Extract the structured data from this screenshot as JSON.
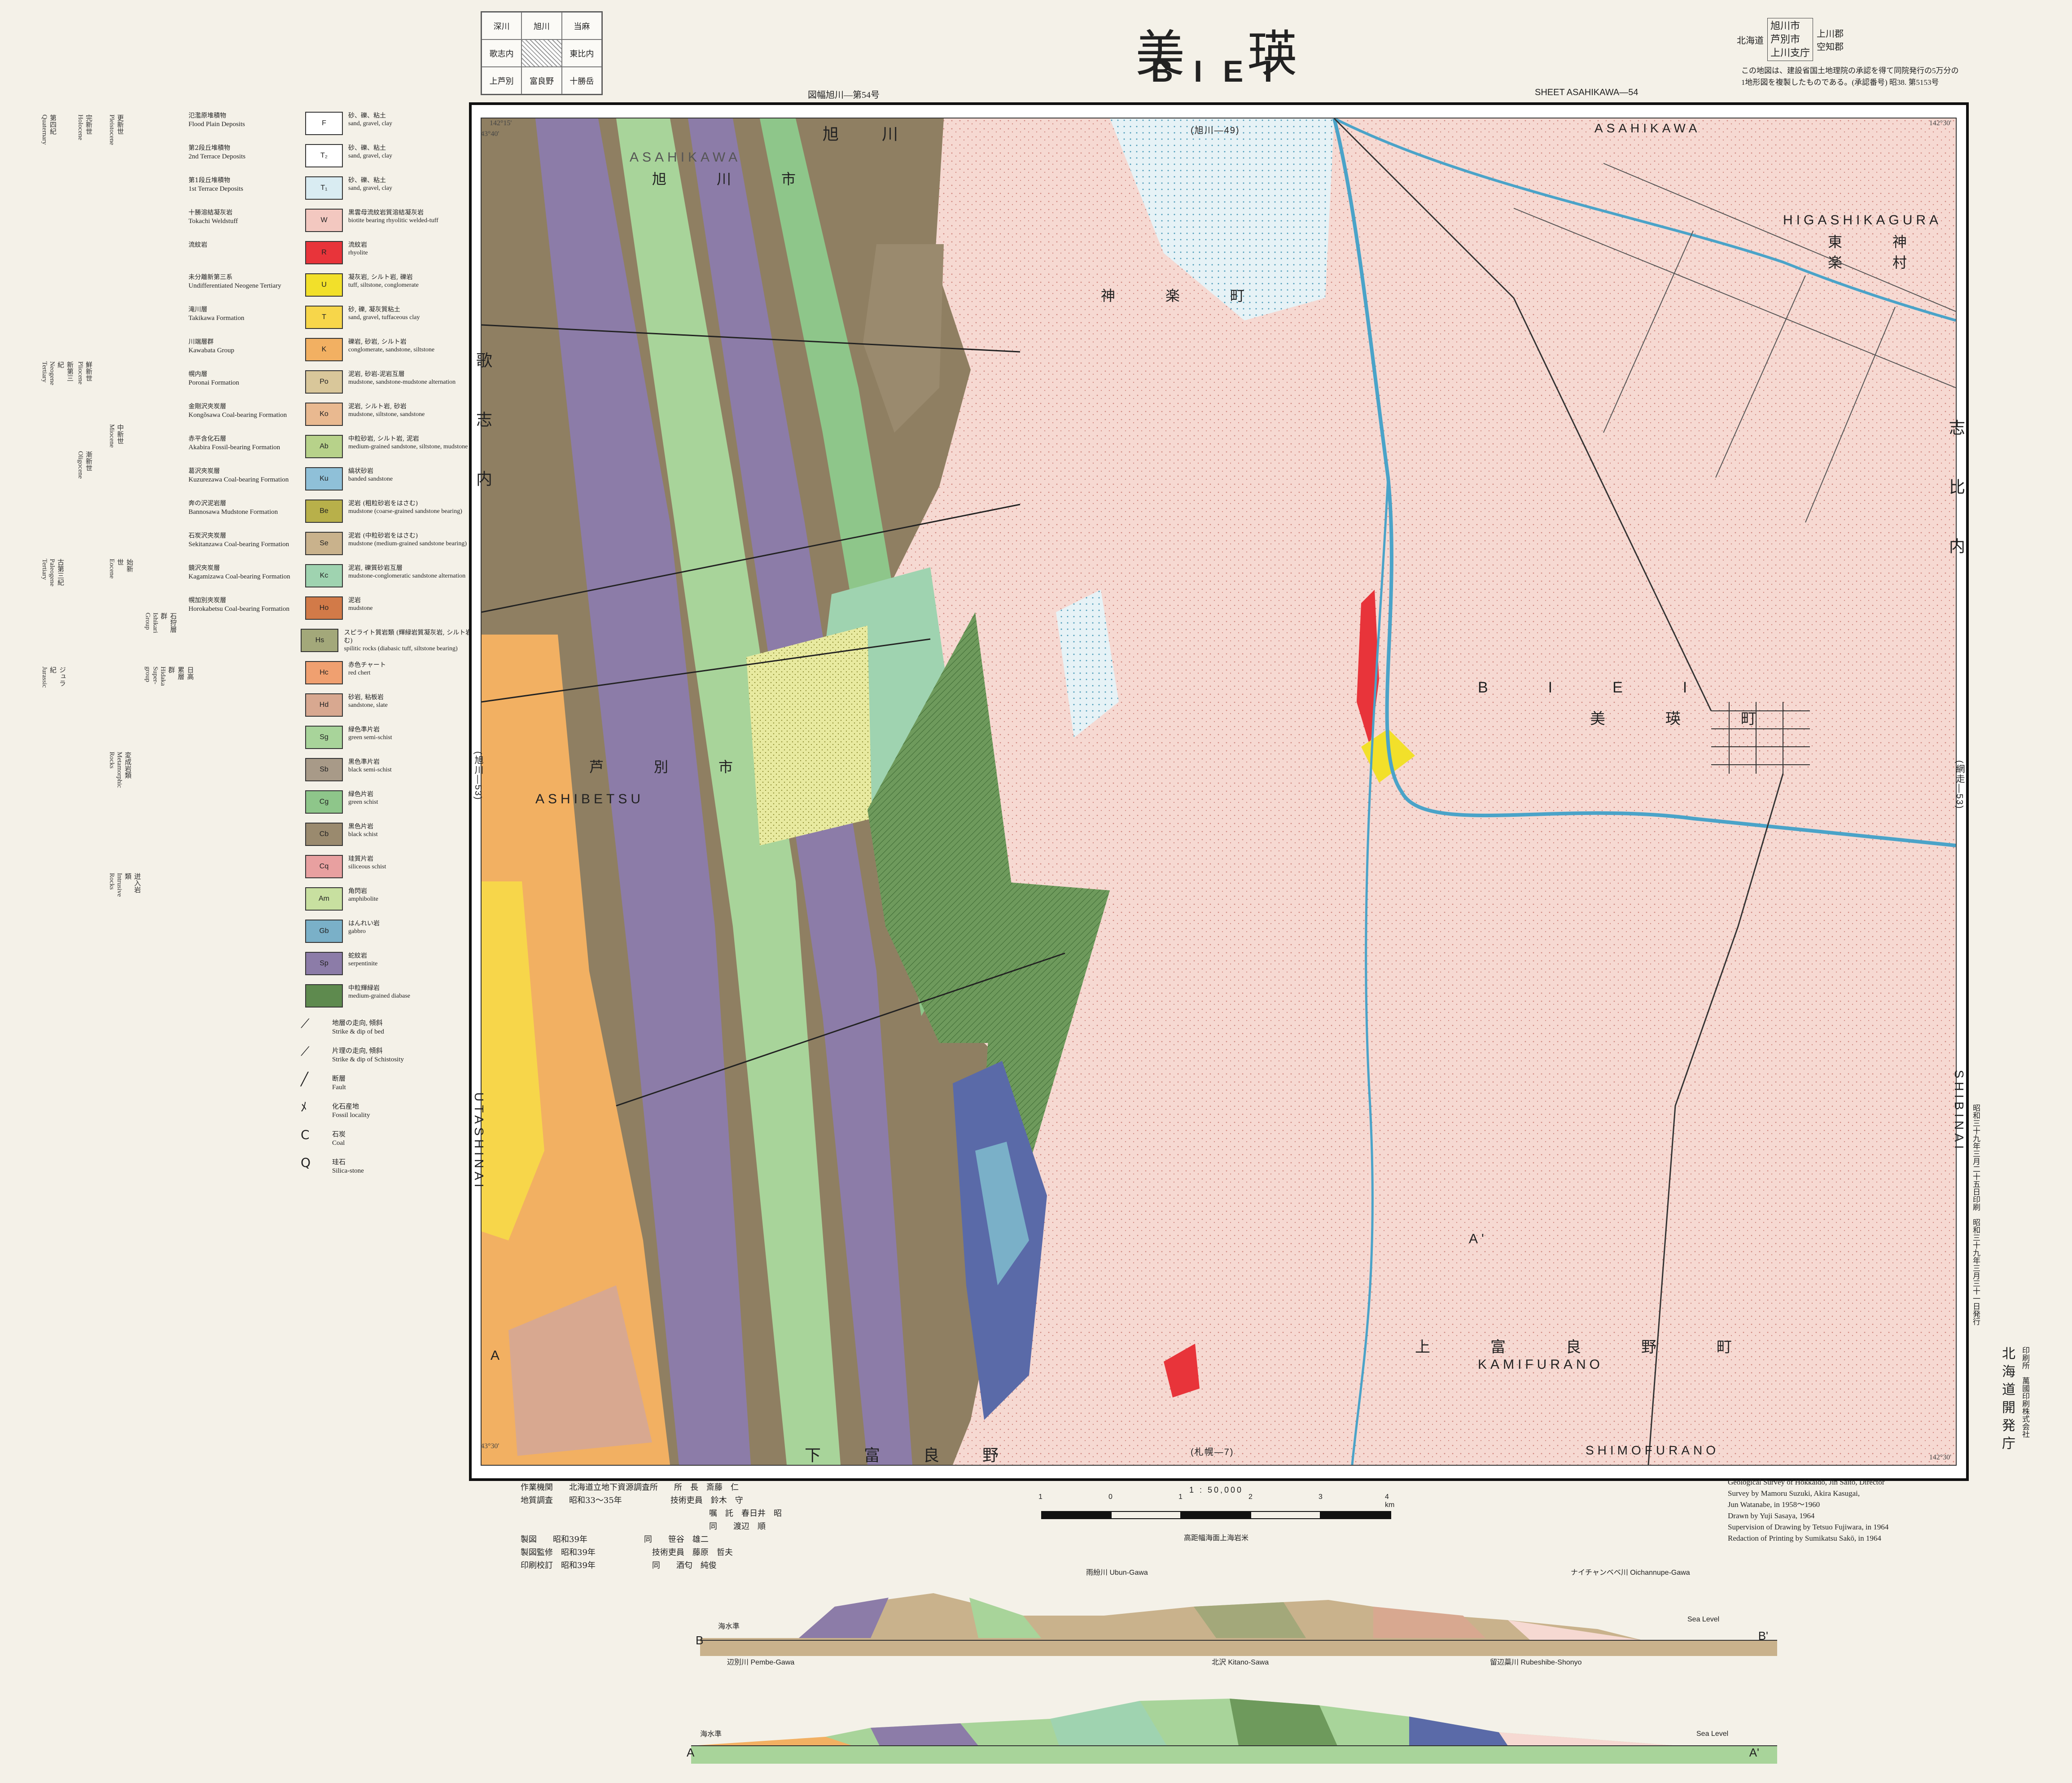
{
  "header": {
    "title_jp": "美瑛",
    "title_en": "BIEI",
    "series_left": "図幅旭川—第54号",
    "series_right": "SHEET ASAHIKAWA—54",
    "index_grid": [
      "深川",
      "旭川",
      "当麻",
      "歌志内",
      "",
      "東比内",
      "上芦別",
      "富良野",
      "十勝岳"
    ],
    "prefecture": "北海道",
    "districts_a": [
      "旭川市",
      "芦別市",
      "上川支庁"
    ],
    "districts_b": [
      "上川郡",
      "空知郡"
    ],
    "note_line1": "この地図は、建設省国土地理院の承認を得て同院発行の5万分の",
    "note_line2": "1地形図を複製したものである。(承認番号) 昭38. 第5153号"
  },
  "map": {
    "edge_top_jp": "旭　川",
    "edge_top_ref": "(旭川—49)",
    "edge_top_en": "ASAHIKAWA",
    "edge_bottom_jp": "下　富　良　野",
    "edge_bottom_ref": "(札幌—7)",
    "edge_bottom_en": "SHIMOFURANO",
    "edge_left_jp": "歌　志　内",
    "edge_left_ref": "(旭川—53)",
    "edge_left_en": "UTASHINAI",
    "edge_right_jp": "志　比　内",
    "edge_right_ref": "(網走—53)",
    "edge_right_en": "SHIBINAI",
    "coord_tl_lon": "142°15'",
    "coord_tl_lat": "43°40'",
    "coord_tr_lon": "142°30'",
    "coord_bl_lat": "43°30'",
    "coord_br_lon": "142°30'",
    "place_labels": [
      "ASAHIKAWA",
      "旭　川　市",
      "HIGASHIKAGURA",
      "東　神　楽　村",
      "神　楽　町",
      "B　I　E　I",
      "美　瑛　町",
      "芦　別　市",
      "ASHIBETSU",
      "上　富　良　野　町",
      "KAMIFURANO",
      "A",
      "A'"
    ]
  },
  "legend": {
    "eras": [
      {
        "jp": "第四紀",
        "en": "Quaternary"
      },
      {
        "jp": "完新世",
        "en": "Holocene"
      },
      {
        "jp": "更新世",
        "en": "Pleistocene"
      },
      {
        "jp": "新第三紀",
        "en": "Neogene Tertiary"
      },
      {
        "jp": "鮮新世",
        "en": "Pliocene"
      },
      {
        "jp": "中新世",
        "en": "Miocene"
      },
      {
        "jp": "古第三紀",
        "en": "Paleogene Tertiary"
      },
      {
        "jp": "漸新世",
        "en": "Oligocene"
      },
      {
        "jp": "始新世",
        "en": "Eocene"
      },
      {
        "jp": "ジュラ紀",
        "en": "Jurassic"
      },
      {
        "jp": "変成岩類",
        "en": "Metamorphic Rocks"
      },
      {
        "jp": "迸入岩類",
        "en": "Intrusive Rocks"
      },
      {
        "jp": "石狩層群",
        "en": "Ishikari Group"
      },
      {
        "jp": "日高累層群",
        "en": "Hidaka Super-group"
      }
    ],
    "units": [
      {
        "code": "F",
        "color": "#ffffff",
        "name_jp": "氾濫原堆積物",
        "name_en": "Flood Plain Deposits",
        "desc_jp": "砂、礫、粘土",
        "desc_en": "sand, gravel, clay"
      },
      {
        "code": "T₂",
        "color": "#ffffff",
        "name_jp": "第2段丘堆積物",
        "name_en": "2nd Terrace Deposits",
        "desc_jp": "砂、礫、粘土",
        "desc_en": "sand, gravel, clay"
      },
      {
        "code": "T₁",
        "color": "#d9ecf2",
        "name_jp": "第1段丘堆積物",
        "name_en": "1st Terrace Deposits",
        "desc_jp": "砂、礫、粘土",
        "desc_en": "sand, gravel, clay"
      },
      {
        "code": "W",
        "color": "#f3c8c0",
        "name_jp": "十勝溶結凝灰岩",
        "name_en": "Tokachi Weldstuff",
        "desc_jp": "黒雲母流紋岩質溶結凝灰岩",
        "desc_en": "biotite bearing rhyolitic welded-tuff"
      },
      {
        "code": "R",
        "color": "#e8343a",
        "name_jp": "流紋岩",
        "name_en": "",
        "desc_jp": "流紋岩",
        "desc_en": "rhyolite"
      },
      {
        "code": "U",
        "color": "#f2e02a",
        "name_jp": "未分離新第三系",
        "name_en": "Undifferentiated Neogene Tertiary",
        "desc_jp": "凝灰岩, シルト岩, 礫岩",
        "desc_en": "tuff, siltstone, conglomerate"
      },
      {
        "code": "T",
        "color": "#f7d64a",
        "name_jp": "滝川層",
        "name_en": "Takikawa Formation",
        "desc_jp": "砂, 礫, 凝灰質粘土",
        "desc_en": "sand, gravel, tuffaceous clay"
      },
      {
        "code": "K",
        "color": "#f2b062",
        "name_jp": "川端層群",
        "name_en": "Kawabata Group",
        "desc_jp": "礫岩, 砂岩, シルト岩",
        "desc_en": "conglomerate, sandstone, siltstone"
      },
      {
        "code": "Po",
        "color": "#d9c79a",
        "name_jp": "幌内層",
        "name_en": "Poronai Formation",
        "desc_jp": "泥岩, 砂岩-泥岩互層",
        "desc_en": "mudstone, sandstone-mudstone alternation"
      },
      {
        "code": "Ko",
        "color": "#e9b990",
        "name_jp": "金剛沢夾炭層",
        "name_en": "Kongõsawa Coal-bearing Formation",
        "desc_jp": "泥岩, シルト岩, 砂岩",
        "desc_en": "mudstone, siltstone, sandstone"
      },
      {
        "code": "Ab",
        "color": "#b7d28a",
        "name_jp": "赤平含化石層",
        "name_en": "Akabira Fossil-bearing Formation",
        "desc_jp": "中粒砂岩, シルト岩, 泥岩",
        "desc_en": "medium-grained sandstone, siltstone, mudstone"
      },
      {
        "code": "Ku",
        "color": "#8fc0d8",
        "name_jp": "葛沢夾炭層",
        "name_en": "Kuzurezawa Coal-bearing Formation",
        "desc_jp": "縞状砂岩",
        "desc_en": "banded sandstone"
      },
      {
        "code": "Be",
        "color": "#b8b04a",
        "name_jp": "奔の沢泥岩層",
        "name_en": "Bannosawa Mudstone Formation",
        "desc_jp": "泥岩 (粗粒砂岩をはさむ)",
        "desc_en": "mudstone (coarse-grained sandstone bearing)"
      },
      {
        "code": "Se",
        "color": "#c9b28c",
        "name_jp": "石炭沢夾炭層",
        "name_en": "Sekitanzawa Coal-bearing Formation",
        "desc_jp": "泥岩 (中粒砂岩をはさむ)",
        "desc_en": "mudstone (medium-grained sandstone bearing)"
      },
      {
        "code": "Kc",
        "color": "#9fd3b0",
        "name_jp": "鏡沢夾炭層",
        "name_en": "Kagamizawa Coal-bearing Formation",
        "desc_jp": "泥岩, 礫質砂岩互層",
        "desc_en": "mudstone-conglomeratic sandstone alternation"
      },
      {
        "code": "Ho",
        "color": "#d27a48",
        "name_jp": "幌加別夾炭層",
        "name_en": "Horokabetsu Coal-bearing Formation",
        "desc_jp": "泥岩",
        "desc_en": "mudstone"
      },
      {
        "code": "Hs",
        "color": "#a3a87a",
        "name_jp": "",
        "name_en": "",
        "desc_jp": "スピライト質岩類 (輝緑岩質凝灰岩, シルト岩をはさむ)",
        "desc_en": "spilitic rocks (diabasic tuff, siltstone bearing)"
      },
      {
        "code": "Hc",
        "color": "#f0a070",
        "name_jp": "",
        "name_en": "",
        "desc_jp": "赤色チャート",
        "desc_en": "red chert"
      },
      {
        "code": "Hd",
        "color": "#d8a890",
        "name_jp": "",
        "name_en": "",
        "desc_jp": "砂岩, 粘板岩",
        "desc_en": "sandstone, slate"
      },
      {
        "code": "Sg",
        "color": "#a8d49a",
        "name_jp": "",
        "name_en": "",
        "desc_jp": "緑色準片岩",
        "desc_en": "green semi-schist"
      },
      {
        "code": "Sb",
        "color": "#a89a88",
        "name_jp": "",
        "name_en": "",
        "desc_jp": "黒色準片岩",
        "desc_en": "black semi-schist"
      },
      {
        "code": "Cg",
        "color": "#8ec68a",
        "name_jp": "",
        "name_en": "",
        "desc_jp": "緑色片岩",
        "desc_en": "green schist"
      },
      {
        "code": "Cb",
        "color": "#9a8a6e",
        "name_jp": "",
        "name_en": "",
        "desc_jp": "黒色片岩",
        "desc_en": "black schist"
      },
      {
        "code": "Cq",
        "color": "#e8a0a0",
        "name_jp": "",
        "name_en": "",
        "desc_jp": "珪質片岩",
        "desc_en": "siliceous schist"
      },
      {
        "code": "Am",
        "color": "#c8e0a0",
        "name_jp": "",
        "name_en": "",
        "desc_jp": "角閃岩",
        "desc_en": "amphibolite"
      },
      {
        "code": "Gb",
        "color": "#7ab0c8",
        "name_jp": "",
        "name_en": "",
        "desc_jp": "はんれい岩",
        "desc_en": "gabbro"
      },
      {
        "code": "Sp",
        "color": "#8c7ca8",
        "name_jp": "",
        "name_en": "",
        "desc_jp": "蛇紋岩",
        "desc_en": "serpentinite"
      },
      {
        "code": "",
        "color": "#5e8a4e",
        "name_jp": "",
        "name_en": "",
        "desc_jp": "中粒輝緑岩",
        "desc_en": "medium-grained diabase"
      }
    ],
    "symbols": [
      {
        "icon": "strike-dip-bed-icon",
        "glyph": "⟋",
        "jp": "地層の走向, 傾斜",
        "en": "Strike & dip of bed"
      },
      {
        "icon": "strike-dip-schistosity-icon",
        "glyph": "⟋",
        "jp": "片理の走向, 傾斜",
        "en": "Strike & dip of Schistosity"
      },
      {
        "icon": "fault-icon",
        "glyph": "╱",
        "jp": "断層",
        "en": "Fault"
      },
      {
        "icon": "fossil-icon",
        "glyph": "ﾒ",
        "jp": "化石産地",
        "en": "Fossil locality"
      },
      {
        "icon": "coal-icon",
        "glyph": "C",
        "jp": "石炭",
        "en": "Coal"
      },
      {
        "icon": "silica-icon",
        "glyph": "Q",
        "jp": "珪石",
        "en": "Silica-stone"
      }
    ]
  },
  "credits": {
    "agency_label": "作業機関",
    "agency": "北海道立地下資源調査所",
    "survey_label": "地質調査",
    "survey_period": "昭和33〜35年",
    "drawing_label": "製図",
    "drawing_year": "昭和39年",
    "supervision_label": "製図監修",
    "supervision_year": "昭和39年",
    "printing_label": "印刷校訂",
    "printing_year": "昭和39年",
    "staff": [
      "所　長　斎藤　仁",
      "技術吏員　鈴木　守",
      "嘱　託　春日井　昭",
      "同　　渡辺　順",
      "同　　笹谷　雄二",
      "技術吏員　藤原　哲夫",
      "同　　酒匂　純俊"
    ],
    "en_lines": [
      "Geological Survey of Hokkaido, Jin Saito, Director",
      "Survey by Mamoru Suzuki, Akira Kasugai,",
      "Jun Watanabe, in 1958〜1960",
      "Drawn by Yuji Sasaya, 1964",
      "Supervision of Drawing by Tetsuo Fujiwara, in 1964",
      "Redaction of Printing by Sumikatsu Sakō, in 1964"
    ],
    "publisher": "北海道開発庁",
    "printer": "印刷所　萬國印刷株式会社",
    "right_side_dates": "昭和三十九年三月二十五日印刷　昭和三十九年三月三十一日発行"
  },
  "scale": {
    "label": "1 : 50,000",
    "ticks": [
      "1",
      "0",
      "1",
      "2",
      "3",
      "4 km"
    ],
    "note": "高距幅海面上海岩米"
  },
  "sections": {
    "b_start": "B",
    "b_end": "B'",
    "a_start": "A",
    "a_end": "A'",
    "sea_level": "Sea Level",
    "sea_level_jp": "海水準",
    "b_places": [
      "雨紛川 Ubun-Gawa",
      "ナイチャンベベ川 Oichannupe-Gawa"
    ],
    "a_places": [
      "辺別川 Pembe-Gawa",
      "北沢 Kitano-Sawa",
      "留辺蘂川 Rubeshibe-Shonyo"
    ]
  },
  "colors": {
    "frame": "#111111",
    "map_background": "#f6d9d2",
    "water": "#4aa3c8"
  }
}
